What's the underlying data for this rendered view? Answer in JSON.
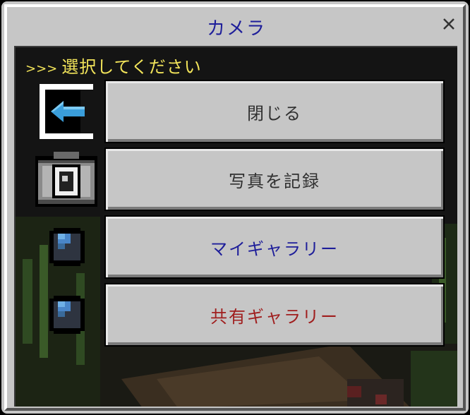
{
  "window": {
    "title": "カメラ",
    "close_glyph": "✕"
  },
  "prompt": {
    "chevrons": ">>>",
    "text": "選択してください"
  },
  "menu": [
    {
      "label": "閉じる",
      "color": "#303030",
      "icon": "exit-arrow-icon"
    },
    {
      "label": "写真を記録",
      "color": "#303030",
      "icon": "camera-icon"
    },
    {
      "label": "マイギャラリー",
      "color": "#1e1e9a",
      "icon": "lens-icon"
    },
    {
      "label": "共有ギャラリー",
      "color": "#a01e1e",
      "icon": "lens-icon"
    }
  ],
  "colors": {
    "panel_bg": "#c6c6c6",
    "content_bg": "#141414",
    "title_color": "#1e1e9a",
    "prompt_color": "#f2e45a"
  }
}
